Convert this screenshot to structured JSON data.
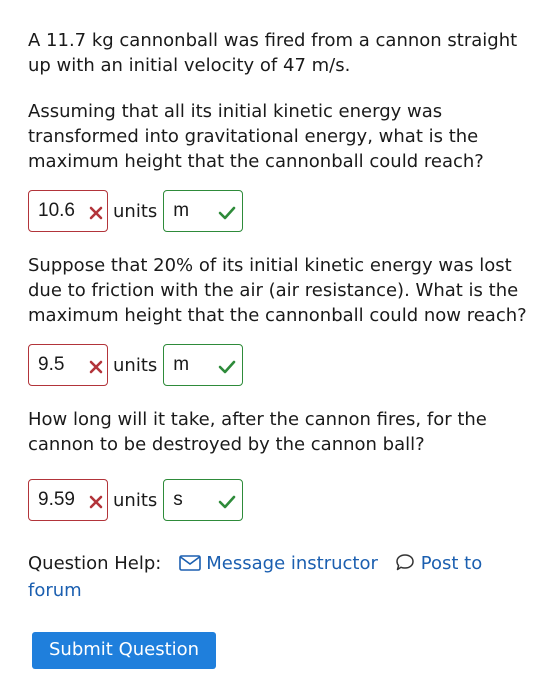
{
  "problem": {
    "intro": "A 11.7 kg cannonball was fired from a cannon straight up with an initial velocity of 47 m/s.",
    "q1": "Assuming that all its initial kinetic energy was transformed into gravitational energy, what is the maximum height that the cannonball could reach?",
    "q2": "Suppose that 20% of its initial kinetic energy was lost due to friction with the air (air resistance). What is the maximum height that the cannonball could now reach?",
    "q3": "How long will it take, after the cannon fires, for the cannon to be destroyed by the cannon ball?"
  },
  "answers": [
    {
      "value": "10.6",
      "units_label": "units",
      "unit": "m",
      "value_status": "incorrect",
      "unit_status": "correct"
    },
    {
      "value": "9.5",
      "units_label": "units",
      "unit": "m",
      "value_status": "incorrect",
      "unit_status": "correct"
    },
    {
      "value": "9.59",
      "units_label": "units",
      "unit": "s",
      "value_status": "incorrect",
      "unit_status": "correct"
    }
  ],
  "help": {
    "label": "Question Help:",
    "message_link": "Message instructor",
    "forum_link": "Post to forum"
  },
  "submit_label": "Submit Question",
  "colors": {
    "incorrect": "#b2343a",
    "correct": "#2e8b3a",
    "link": "#1b5fb0",
    "button": "#1f7fdc"
  },
  "icons": {
    "incorrect": "x-icon",
    "correct": "checkmark-icon",
    "message": "envelope-icon",
    "forum": "speech-bubble-icon"
  }
}
